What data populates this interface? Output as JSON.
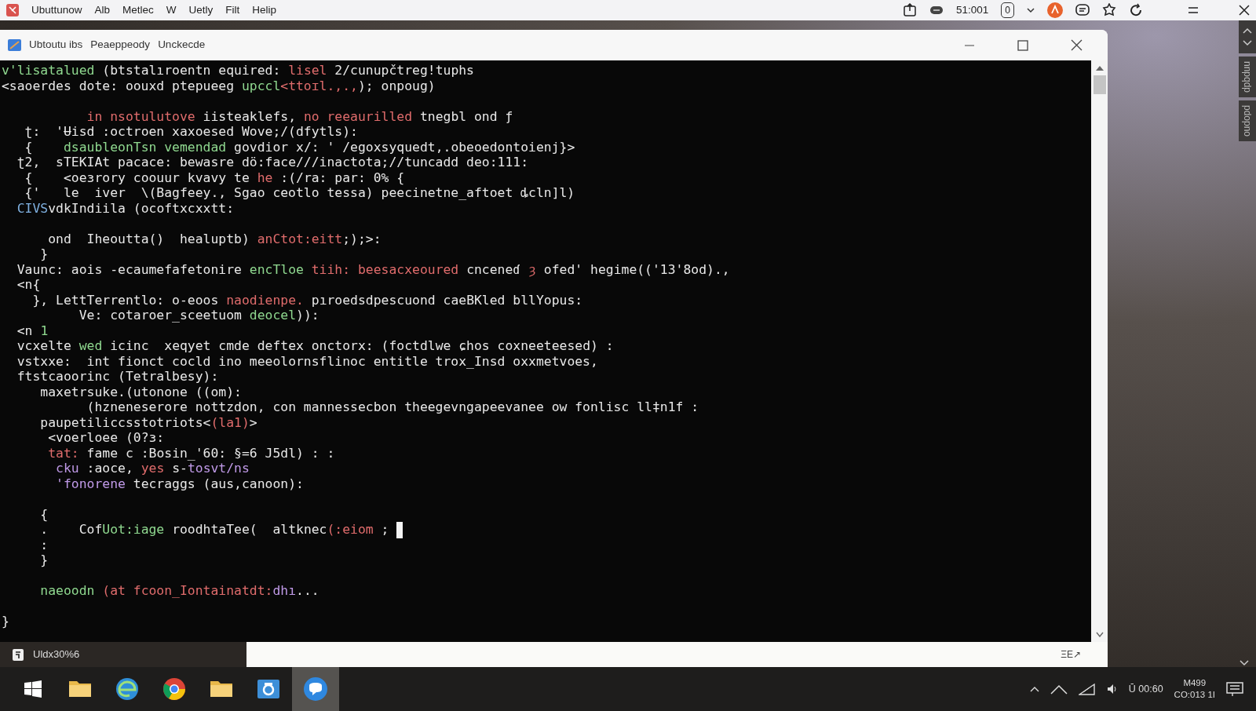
{
  "menubar": {
    "items": [
      "Ubuttunow",
      "Alb",
      "Metlec",
      "W",
      "Uetly",
      "Filt",
      "Helip"
    ],
    "status_text": "51:001",
    "badge": "0"
  },
  "window": {
    "title_parts": [
      "Ubtoutu ibs",
      "Peaeppeody",
      "Unckecde"
    ]
  },
  "terminal": {
    "lines": [
      {
        "segments": [
          {
            "text": "v'lisatalued",
            "color": "#8fd88f"
          },
          {
            "text": " (btstalıroentn equired: ",
            "color": "#e8e8e8"
          },
          {
            "text": "lisel",
            "color": "#e06c6c"
          },
          {
            "text": " 2/cunupčtreg!tuphs",
            "color": "#e8e8e8"
          }
        ]
      },
      {
        "segments": [
          {
            "text": "<saoerdes dote: oouxd ptepueeg ",
            "color": "#e8e8e8"
          },
          {
            "text": "upccl",
            "color": "#8fd88f"
          },
          {
            "text": "<ttoɪl.,.,",
            "color": "#e06c6c"
          },
          {
            "text": "); onpoug)",
            "color": "#e8e8e8"
          }
        ]
      },
      {
        "blank_before": true,
        "segments": [
          {
            "text": "           in nsotulutove ",
            "color": "#e06c6c"
          },
          {
            "text": "iisteaklefs, ",
            "color": "#e8e8e8"
          },
          {
            "text": "no reeaurilled ",
            "color": "#e06c6c"
          },
          {
            "text": "tnegbl ond ƒ",
            "color": "#e8e8e8"
          }
        ]
      },
      {
        "segments": [
          {
            "text": "   ʈ:  'Ʉisd :octroen xaxoesed Wove;/(dfytls):",
            "color": "#e8e8e8"
          }
        ]
      },
      {
        "segments": [
          {
            "text": "   {    ",
            "color": "#e8e8e8"
          },
          {
            "text": "dsaubleonTsn vemendad",
            "color": "#8fd88f"
          },
          {
            "text": " govdior x/: ' /egoxsyquedt,.obeoedontoienj}>",
            "color": "#e8e8e8"
          }
        ]
      },
      {
        "segments": [
          {
            "text": "  ʈ2,  sTEKIAt pacace: bewasre dö:face///inactota;//tuncadd deo:111:",
            "color": "#e8e8e8"
          }
        ]
      },
      {
        "segments": [
          {
            "text": "   {    <oeɜrory coouur kvavy te ",
            "color": "#e8e8e8"
          },
          {
            "text": "he",
            "color": "#e06c6c"
          },
          {
            "text": " :(/ra: par: 0% {",
            "color": "#e8e8e8"
          }
        ]
      },
      {
        "segments": [
          {
            "text": "   {'   le  iver  \\(Bagfeey., Sgao ceotlo tessa) peecinetne_aftoet ȡcln]l)",
            "color": "#e8e8e8"
          }
        ]
      },
      {
        "segments": [
          {
            "text": "  CIVS",
            "color": "#7fb0e0"
          },
          {
            "text": "vdkIndiila (ocoftxcxxtt:",
            "color": "#e8e8e8"
          }
        ]
      },
      {
        "blank_before": true,
        "segments": [
          {
            "text": "      ond  Iheoutta()  healuptb) ",
            "color": "#e8e8e8"
          },
          {
            "text": "anCtot:eitt",
            "color": "#e06c6c"
          },
          {
            "text": ";);>:",
            "color": "#e8e8e8"
          }
        ]
      },
      {
        "segments": [
          {
            "text": "     }",
            "color": "#e8e8e8"
          }
        ]
      },
      {
        "segments": [
          {
            "text": "  Vaunc: aois -ecaumefafetonire ",
            "color": "#e8e8e8"
          },
          {
            "text": "encTloe",
            "color": "#8fd88f"
          },
          {
            "text": " tiih: beesacxeoured",
            "color": "#e06c6c"
          },
          {
            "text": " cnceneɗ ",
            "color": "#e8e8e8"
          },
          {
            "text": "ȝ",
            "color": "#e06c6c"
          },
          {
            "text": " ofed' hegime(('13'8od).,",
            "color": "#e8e8e8"
          }
        ]
      },
      {
        "segments": [
          {
            "text": "  <n{",
            "color": "#e8e8e8"
          }
        ]
      },
      {
        "segments": [
          {
            "text": "    }, LettTerrentlo: o-eoos ",
            "color": "#e8e8e8"
          },
          {
            "text": "naodienpe.",
            "color": "#e06c6c"
          },
          {
            "text": " pıroedsdpescuond caeBKled bllYopus:",
            "color": "#e8e8e8"
          }
        ]
      },
      {
        "segments": [
          {
            "text": "          Ve: cotaroer_sceetuom ",
            "color": "#e8e8e8"
          },
          {
            "text": "deocel",
            "color": "#8fd88f"
          },
          {
            "text": ")):",
            "color": "#e8e8e8"
          }
        ]
      },
      {
        "segments": [
          {
            "text": "  <n ",
            "color": "#e8e8e8"
          },
          {
            "text": "1",
            "color": "#8fd88f"
          }
        ]
      },
      {
        "segments": [
          {
            "text": "  vcxelte ",
            "color": "#e8e8e8"
          },
          {
            "text": "wed",
            "color": "#8fd88f"
          },
          {
            "text": " icinc  xeqyet cmde deftex onctorx: (foctdlwe ɕhos coxneeteesed) :",
            "color": "#e8e8e8"
          }
        ]
      },
      {
        "segments": [
          {
            "text": "  vstxxe:  int fionct cocld ino meeolornsflinoc entitle trox_Insd oxxmetvoes,",
            "color": "#e8e8e8"
          }
        ]
      },
      {
        "segments": [
          {
            "text": "  ftstcaoorinc (Tetralbesy):",
            "color": "#e8e8e8"
          }
        ]
      },
      {
        "segments": [
          {
            "text": "     maxetrsuke.(utonone ((om):",
            "color": "#e8e8e8"
          }
        ]
      },
      {
        "segments": [
          {
            "text": "           (hzneneserore nottzdon, con mannessecbon theegevngapeevanee ow fonlisc ll‡n1f :",
            "color": "#e8e8e8"
          }
        ]
      },
      {
        "segments": [
          {
            "text": "     paupetiliccsstotriots<",
            "color": "#e8e8e8"
          },
          {
            "text": "(la1)",
            "color": "#e06c6c"
          },
          {
            "text": ">",
            "color": "#e8e8e8"
          }
        ]
      },
      {
        "segments": [
          {
            "text": "      <voerloee (0?ɜ:",
            "color": "#e8e8e8"
          }
        ]
      },
      {
        "segments": [
          {
            "text": "      tat:",
            "color": "#e06c6c"
          },
          {
            "text": " fame c :Bosin_'60: §=6 J5dl) : :",
            "color": "#e8e8e8"
          }
        ]
      },
      {
        "segments": [
          {
            "text": "       cku",
            "color": "#c09ae8"
          },
          {
            "text": " :aoce, ",
            "color": "#e8e8e8"
          },
          {
            "text": "yes",
            "color": "#e06c6c"
          },
          {
            "text": " s-",
            "color": "#e8e8e8"
          },
          {
            "text": "tosvt/ns",
            "color": "#c09ae8"
          }
        ]
      },
      {
        "segments": [
          {
            "text": "       'fonorene",
            "color": "#c09ae8"
          },
          {
            "text": " tecraggs (aus,canoon):",
            "color": "#e8e8e8"
          }
        ]
      },
      {
        "blank_before": true,
        "segments": [
          {
            "text": "     {",
            "color": "#e8e8e8"
          }
        ]
      },
      {
        "segments": [
          {
            "text": "     .    Cof",
            "color": "#e8e8e8"
          },
          {
            "text": "Uot:iage",
            "color": "#8fd88f"
          },
          {
            "text": " roodhtaTee(  altknec",
            "color": "#e8e8e8"
          },
          {
            "text": "(:eiom",
            "color": "#e06c6c"
          },
          {
            "text": " ; ",
            "color": "#e8e8e8"
          }
        ],
        "cursor": true
      },
      {
        "segments": [
          {
            "text": "     :",
            "color": "#e8e8e8"
          }
        ]
      },
      {
        "segments": [
          {
            "text": "     }",
            "color": "#e8e8e8"
          }
        ]
      },
      {
        "blank_before": true,
        "segments": [
          {
            "text": "     naeoodn",
            "color": "#8fd88f"
          },
          {
            "text": " (at fcoon_Iontainatdt:",
            "color": "#e06c6c"
          },
          {
            "text": "dhı",
            "color": "#c09ae8"
          },
          {
            "text": "...",
            "color": "#e8e8e8"
          }
        ]
      },
      {
        "blank_before": true,
        "segments": [
          {
            "text": "}",
            "color": "#e8e8e8"
          }
        ]
      }
    ]
  },
  "bottom_bar": {
    "left_text": "Uldx30%6",
    "right_text": "ΞE↗"
  },
  "side_panel": {
    "labels": [
      "nnpqdp",
      "pdopno"
    ]
  },
  "taskbar": {
    "apps": [
      {
        "kind": "folder",
        "selected": false
      },
      {
        "kind": "globe",
        "selected": false
      },
      {
        "kind": "browser",
        "selected": false
      },
      {
        "kind": "folder",
        "selected": false
      },
      {
        "kind": "camera",
        "selected": false
      },
      {
        "kind": "chat",
        "selected": true
      }
    ],
    "tray_text": "Ū 00:60",
    "clock": [
      "M499",
      "CO:013 1I"
    ]
  }
}
